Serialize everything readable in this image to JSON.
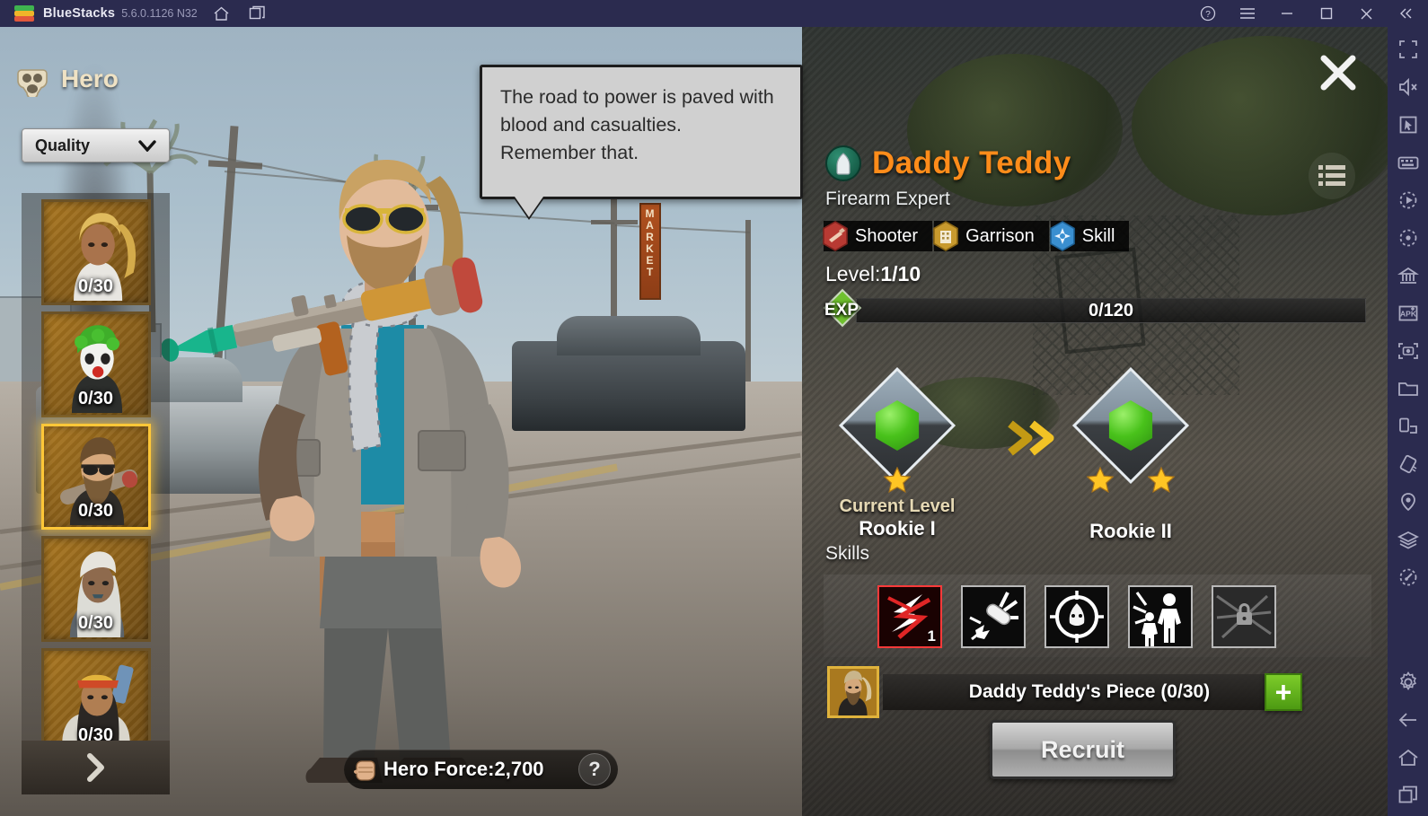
{
  "titlebar": {
    "app_name": "BlueStacks",
    "version": "5.6.0.1126 N32",
    "icons": [
      "home-icon",
      "multi-instance-icon"
    ],
    "right_icons": [
      "help-icon",
      "menu-icon",
      "minimize-icon",
      "maximize-icon",
      "close-icon",
      "collapse-icon"
    ]
  },
  "sidebar": {
    "icons": [
      "fullscreen-icon",
      "mute-icon",
      "cursor-icon",
      "keyboard-controls-icon",
      "macro-icon",
      "sync-icon",
      "multi-instance-manager-icon",
      "install-apk-icon",
      "screenshot-icon",
      "media-folder-icon",
      "rotate-icon",
      "tilt-icon",
      "location-icon",
      "layers-icon",
      "eco-mode-icon"
    ],
    "bottom_icons": [
      "settings-icon",
      "back-icon",
      "home-icon",
      "recent-apps-icon"
    ]
  },
  "left_panel": {
    "title": "Hero",
    "title_icon": "gas-mask-icon",
    "filter": {
      "label": "Quality",
      "chevron": "chevron-down-icon"
    },
    "hero_cards": [
      {
        "count": "0/30",
        "selected": false,
        "name": "hero-blonde-woman"
      },
      {
        "count": "0/30",
        "selected": false,
        "name": "hero-green-hair-clown"
      },
      {
        "count": "0/30",
        "selected": true,
        "name": "hero-daddy-teddy"
      },
      {
        "count": "0/30",
        "selected": false,
        "name": "hero-white-hair-woman"
      },
      {
        "count": "0/30",
        "selected": false,
        "name": "hero-bandana-warrior"
      }
    ],
    "next_icon": "chevron-right-icon"
  },
  "stage": {
    "quote": "The road to power is paved with blood and casualties. Remember that.",
    "hero_force_label": "Hero Force:",
    "hero_force_value": "2,700",
    "hero_force_icon": "fist-icon",
    "help_label": "?"
  },
  "hero_panel": {
    "close_icon": "close-icon",
    "list_icon": "hero-list-icon",
    "name": "Daddy Teddy",
    "name_color": "#ff8c1a",
    "name_badge_icon": "bullet-icon",
    "subtitle": "Firearm Expert",
    "tags": [
      {
        "label": "Shooter",
        "icon": "rifle-icon",
        "color": "#c0392b"
      },
      {
        "label": "Garrison",
        "icon": "building-icon",
        "color": "#c9952a"
      },
      {
        "label": "Skill",
        "icon": "star-burst-icon",
        "color": "#3a8fd0"
      }
    ],
    "level_label": "Level:",
    "level_value": "1/10",
    "exp_label": "EXP",
    "exp_value": "0/120",
    "exp_percent": 0,
    "rank": {
      "current_caption": "Current Level",
      "current_name": "Rookie I",
      "current_stars": 1,
      "next_name": "Rookie II",
      "next_stars": 2,
      "arrow_icon": "double-chevron-right-icon"
    },
    "skills_label": "Skills",
    "skills": [
      {
        "name": "skill-charge",
        "level": "1",
        "active": true,
        "locked": false
      },
      {
        "name": "skill-bullet",
        "level": "",
        "active": false,
        "locked": false
      },
      {
        "name": "skill-target",
        "level": "",
        "active": false,
        "locked": false
      },
      {
        "name": "skill-rally",
        "level": "",
        "active": false,
        "locked": false
      },
      {
        "name": "skill-locked",
        "level": "",
        "active": false,
        "locked": true
      }
    ],
    "piece": {
      "label": "Daddy Teddy's Piece (0/30)",
      "icon": "hero-piece-portrait",
      "add_label": "+"
    },
    "recruit_label": "Recruit",
    "recruit_enabled": false
  }
}
